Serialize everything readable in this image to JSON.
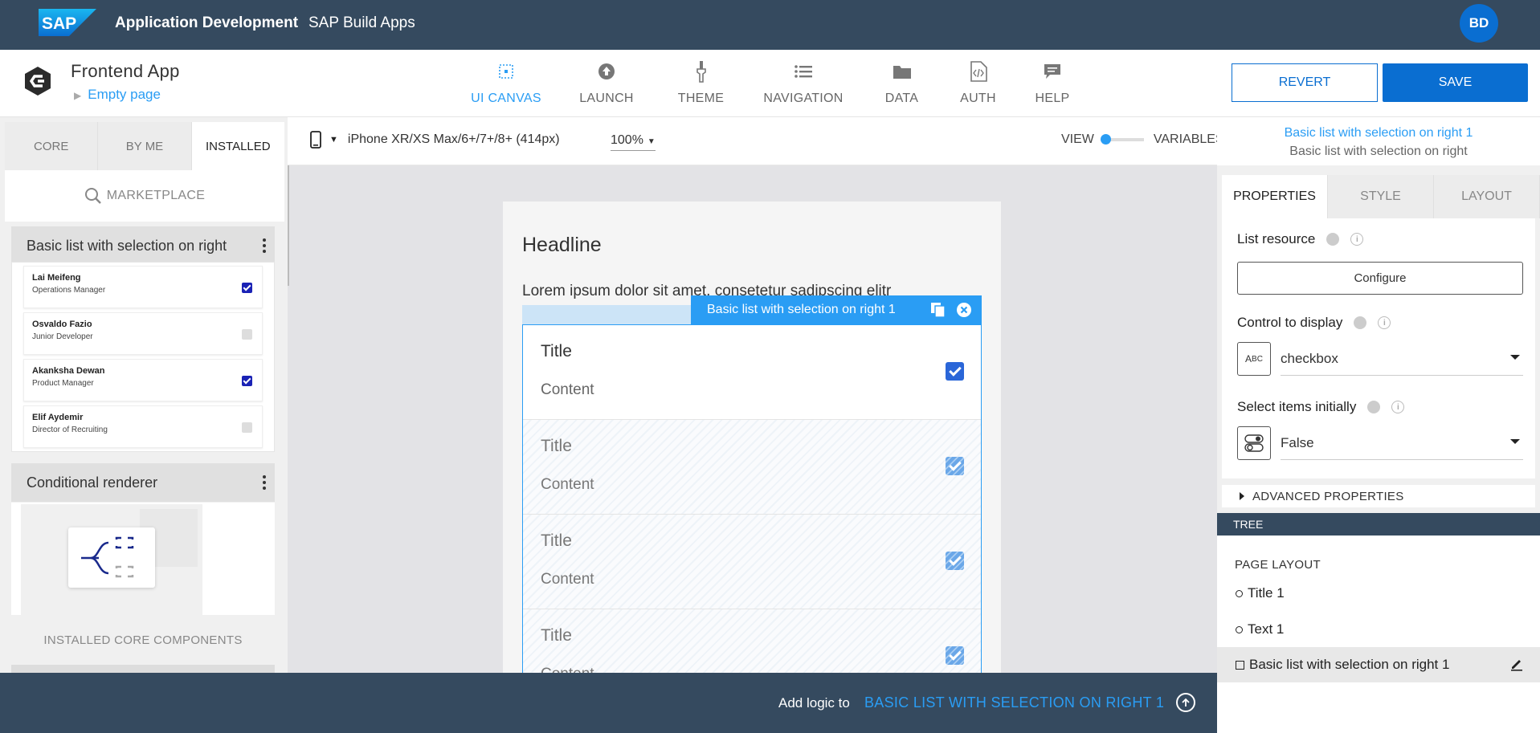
{
  "shell": {
    "brand": "SAP",
    "app_title": "Application Development",
    "product": "SAP Build Apps",
    "avatar_initials": "BD"
  },
  "header": {
    "app_name": "Frontend App",
    "page": "Empty page",
    "nav": [
      {
        "label": "UI CANVAS",
        "icon": "grid-icon",
        "active": true
      },
      {
        "label": "LAUNCH",
        "icon": "upload-icon",
        "active": false
      },
      {
        "label": "THEME",
        "icon": "brush-icon",
        "active": false
      },
      {
        "label": "NAVIGATION",
        "icon": "list-icon",
        "active": false
      },
      {
        "label": "DATA",
        "icon": "folder-icon",
        "active": false
      },
      {
        "label": "AUTH",
        "icon": "file-code-icon",
        "active": false
      },
      {
        "label": "HELP",
        "icon": "chat-icon",
        "active": false
      }
    ],
    "revert_label": "REVERT",
    "save_label": "SAVE"
  },
  "left_panel": {
    "tabs": [
      "CORE",
      "BY ME",
      "INSTALLED"
    ],
    "active_tab": "INSTALLED",
    "marketplace_label": "MARKETPLACE",
    "components": [
      {
        "title": "Basic list with selection on right"
      },
      {
        "title": "Conditional renderer"
      }
    ],
    "preview_items": [
      {
        "name": "Lai Meifeng",
        "role": "Operations Manager",
        "checked": true
      },
      {
        "name": "Osvaldo Fazio",
        "role": "Junior Developer",
        "checked": false
      },
      {
        "name": "Akanksha Dewan",
        "role": "Product Manager",
        "checked": true
      },
      {
        "name": "Elif Aydemir",
        "role": "Director of Recruiting",
        "checked": false
      }
    ],
    "installed_core_label": "INSTALLED CORE COMPONENTS"
  },
  "canvas_toolbar": {
    "device": "iPhone XR/XS Max/6+/7+/8+ (414px)",
    "zoom": "100%",
    "view_label": "VIEW",
    "variables_label": "VARIABLES",
    "selected_name": "Basic list with selection on right 1",
    "selected_type": "Basic list with selection on right"
  },
  "canvas": {
    "headline": "Headline",
    "lorem": "Lorem ipsum dolor sit amet, consetetur sadipscing elitr",
    "selection_tag": "Basic list with selection on right 1",
    "list_items": [
      {
        "title": "Title",
        "content": "Content",
        "checked": true
      },
      {
        "title": "Title",
        "content": "Content",
        "checked": true
      },
      {
        "title": "Title",
        "content": "Content",
        "checked": true
      },
      {
        "title": "Title",
        "content": "Content",
        "checked": true
      }
    ]
  },
  "logic_bar": {
    "text": "Add logic to",
    "target": "BASIC LIST WITH SELECTION ON RIGHT 1"
  },
  "right_panel": {
    "tabs": [
      "PROPERTIES",
      "STYLE",
      "LAYOUT"
    ],
    "active_tab": "PROPERTIES",
    "list_resource_label": "List resource",
    "configure_label": "Configure",
    "control_label": "Control to display",
    "control_value": "checkbox",
    "select_label": "Select items initially",
    "select_value": "False",
    "advanced_label": "ADVANCED PROPERTIES",
    "tree_label": "TREE",
    "page_layout_label": "PAGE LAYOUT",
    "tree_items": [
      {
        "label": "Title 1",
        "shape": "circle",
        "selected": false
      },
      {
        "label": "Text 1",
        "shape": "circle",
        "selected": false
      },
      {
        "label": "Basic list with selection on right 1",
        "shape": "square",
        "selected": true
      }
    ]
  },
  "colors": {
    "shell_bg": "#354a5f",
    "accent": "#2a9df4",
    "primary_button": "#0a6ed1"
  }
}
